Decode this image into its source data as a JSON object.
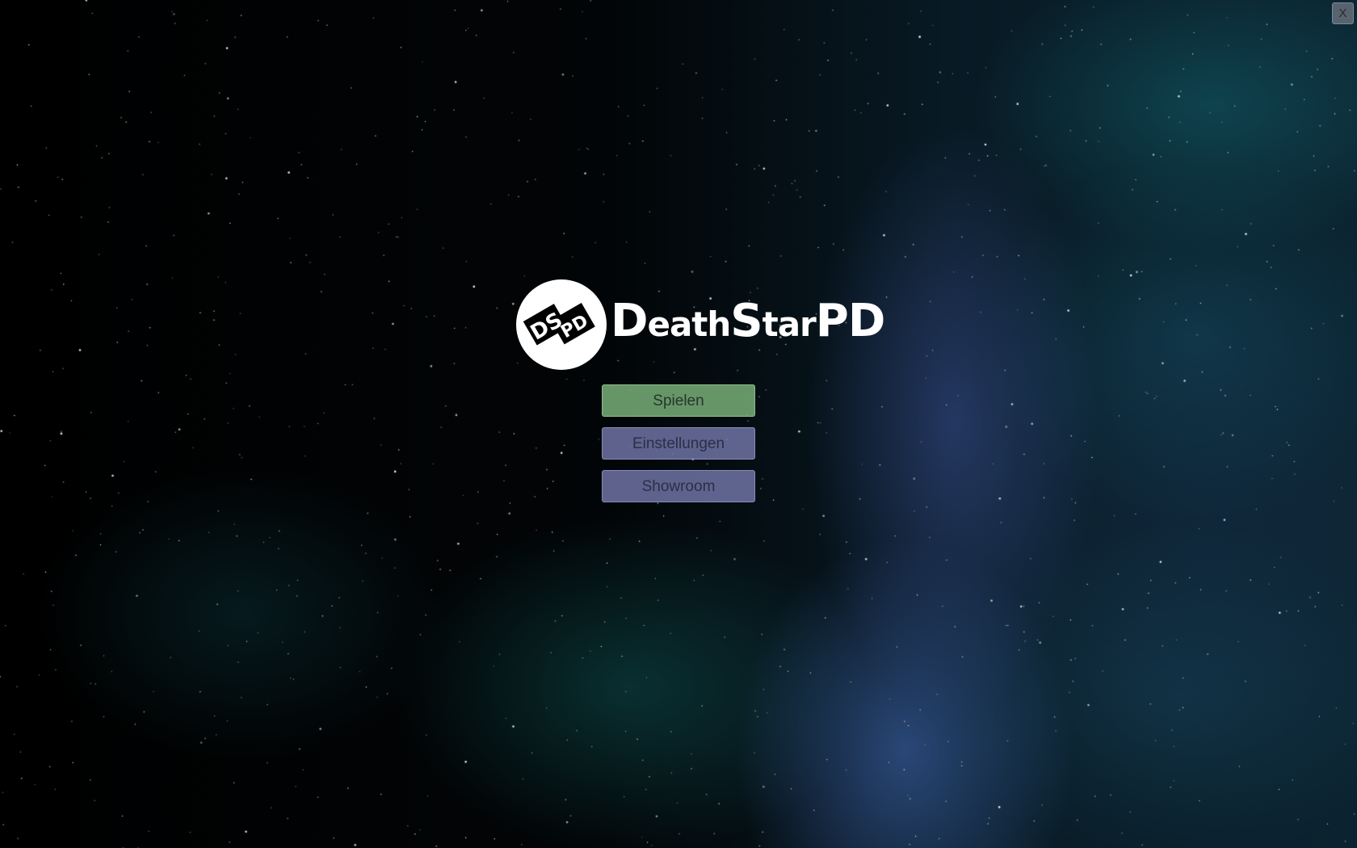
{
  "window": {
    "close_label": "X"
  },
  "logo": {
    "mark_letters_top": "DS",
    "mark_letters_bottom": "PD",
    "title_parts": [
      "D",
      "eath",
      "S",
      "tar",
      "PD"
    ]
  },
  "menu": {
    "play_label": "Spielen",
    "settings_label": "Einstellungen",
    "showroom_label": "Showroom"
  },
  "colors": {
    "play_button": "#78af78",
    "secondary_button": "#7d82b9",
    "background": "#000000",
    "nebula_teal": "#146e78",
    "nebula_blue": "#465aaa"
  }
}
